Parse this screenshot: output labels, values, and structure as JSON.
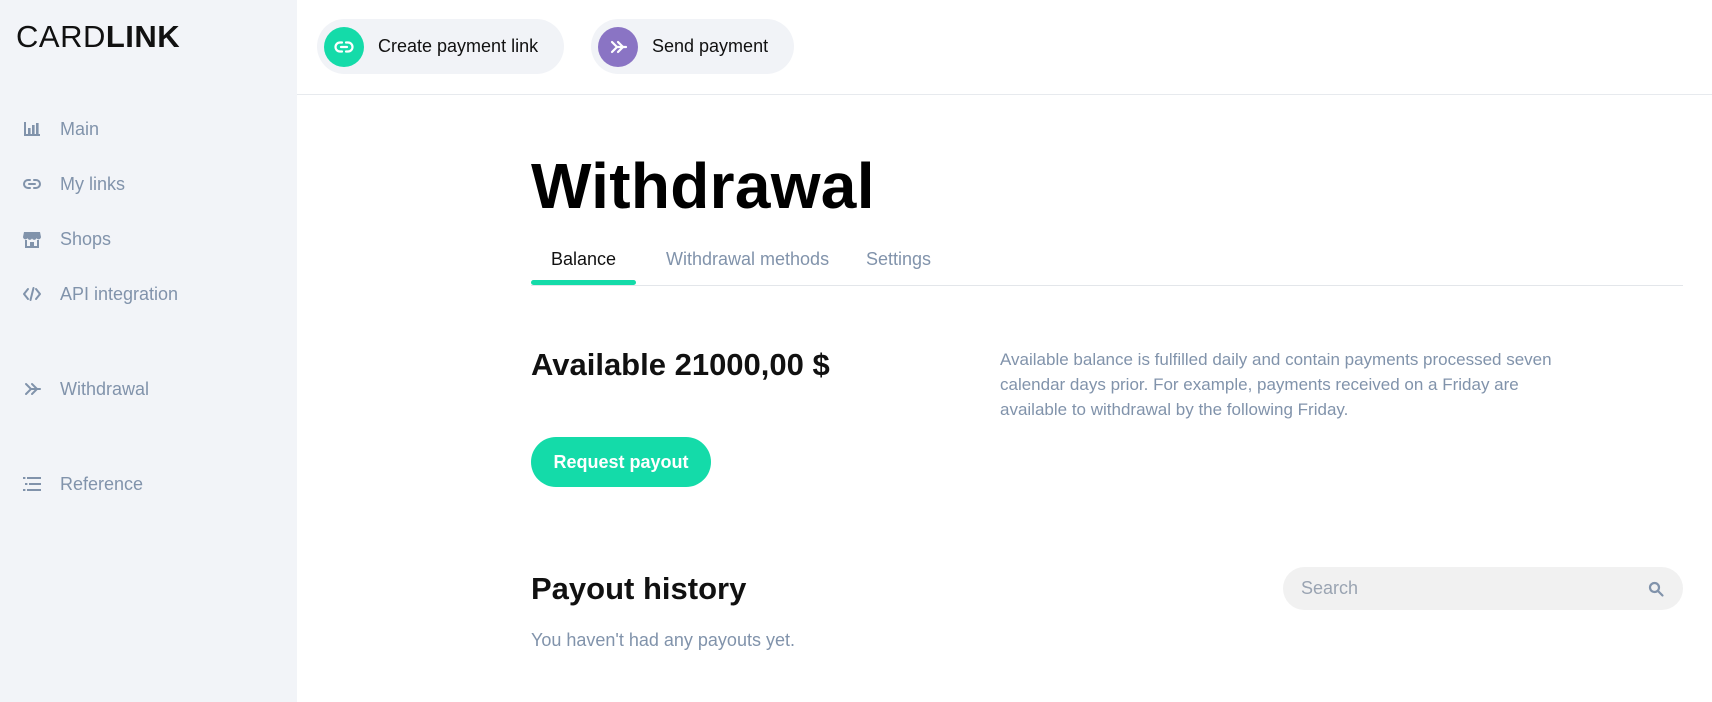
{
  "brand": {
    "part1": "CARD",
    "part2": "LINK"
  },
  "sidebar": {
    "items": [
      {
        "label": "Main",
        "icon": "bar-chart-icon"
      },
      {
        "label": "My links",
        "icon": "link-icon"
      },
      {
        "label": "Shops",
        "icon": "store-icon"
      },
      {
        "label": "API integration",
        "icon": "code-icon"
      },
      {
        "label": "Withdrawal",
        "icon": "double-arrow-icon"
      },
      {
        "label": "Reference",
        "icon": "list-icon"
      }
    ]
  },
  "topbar": {
    "create_link": {
      "label": "Create payment link",
      "icon": "link-icon",
      "color": "#14dba9"
    },
    "send_payment": {
      "label": "Send payment",
      "icon": "double-arrow-icon",
      "color": "#8a74c4"
    }
  },
  "page": {
    "title": "Withdrawal",
    "tabs": [
      {
        "label": "Balance",
        "active": true
      },
      {
        "label": "Withdrawal methods",
        "active": false
      },
      {
        "label": "Settings",
        "active": false
      }
    ],
    "available": "Available 21000,00 $",
    "info": "Available balance is fulfilled daily and contain payments processed seven calendar days prior. For example, payments received on a Friday are available to withdrawal by the following Friday.",
    "request_payout": "Request payout",
    "history_title": "Payout history",
    "search_placeholder": "Search",
    "empty_note": "You haven't had any payouts yet."
  },
  "colors": {
    "accent": "#14dba9",
    "purple": "#8a74c4",
    "muted": "#8193ab",
    "sidebar_bg": "#f2f4f8"
  }
}
